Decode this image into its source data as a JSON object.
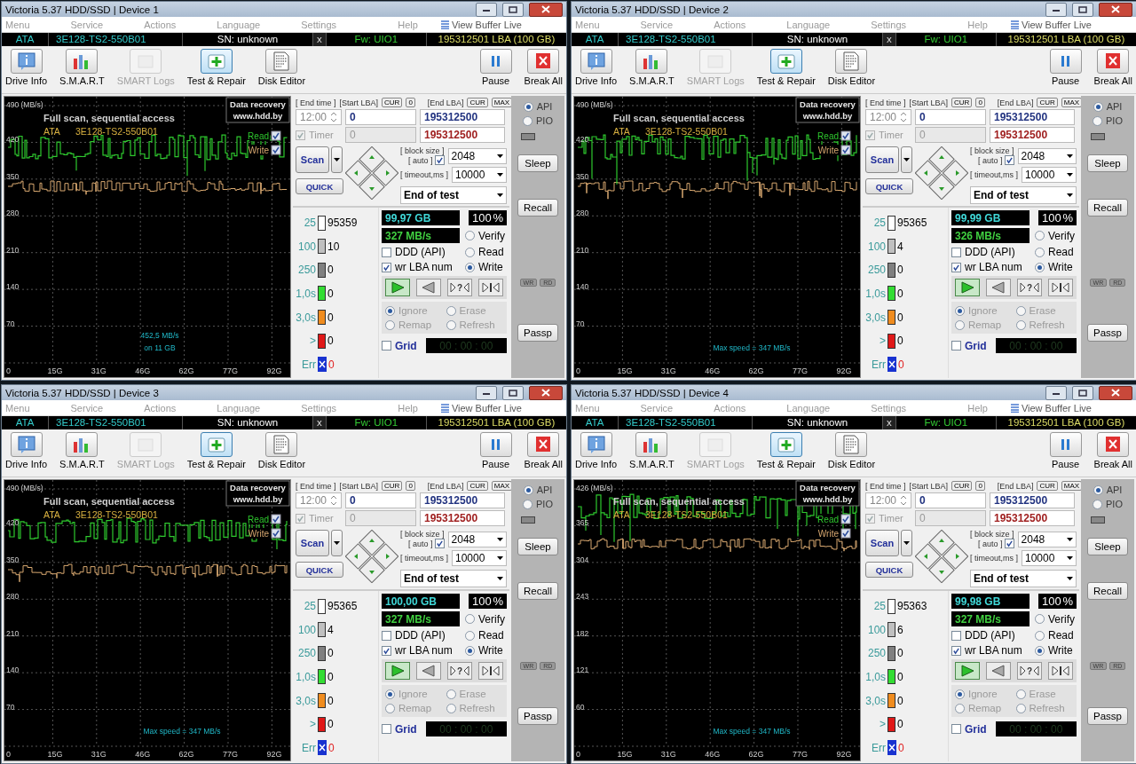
{
  "windows": [
    {
      "title": "Victoria 5.37 HDD/SSD | Device 1",
      "menu": [
        "Menu",
        "Service",
        "Actions",
        "Language",
        "Settings",
        "Help"
      ],
      "buffer_link": "View Buffer Live",
      "drive": {
        "interface": "ATA",
        "model": "3E128-TS2-550B01",
        "serial": "SN: unknown",
        "close": "x",
        "firmware": "Fw: UIO1",
        "capacity": "195312501 LBA (100 GB)"
      },
      "toolbar": [
        {
          "label": "Drive Info",
          "kind": "info",
          "selected": false,
          "disabled": false
        },
        {
          "label": "S.M.A.R.T",
          "kind": "smart",
          "selected": false,
          "disabled": false
        },
        {
          "label": "SMART Logs",
          "kind": "logs",
          "selected": false,
          "disabled": true
        },
        {
          "label": "Test & Repair",
          "kind": "test",
          "selected": true,
          "disabled": false
        },
        {
          "label": "Disk Editor",
          "kind": "editor",
          "selected": false,
          "disabled": false
        }
      ],
      "toolbar_right": [
        {
          "label": "Pause",
          "kind": "pause"
        },
        {
          "label": "Break All",
          "kind": "break"
        }
      ],
      "chart": {
        "y_ticks": [
          "490 (MB/s)",
          "420",
          "350",
          "280",
          "210",
          "140",
          "70"
        ],
        "x_ticks": [
          "0",
          "15G",
          "31G",
          "46G",
          "62G",
          "77G",
          "92G"
        ],
        "title": "Full scan, sequential access",
        "drive_label": "ATA",
        "model": "3E128-TS2-550B01",
        "badge": [
          "Data recovery",
          "www.hdd.by"
        ],
        "legend": [
          {
            "label": "Read",
            "checked": true
          },
          {
            "label": "Write",
            "checked": true
          }
        ],
        "notes": [
          "452,5 MB/s",
          "on 11 GB"
        ]
      },
      "controls": {
        "end_time": {
          "label": "[ End time ]",
          "value": "12:00"
        },
        "timer": {
          "label": "Timer",
          "checked": true
        },
        "start_lba": {
          "label": "[Start LBA]",
          "buttons": [
            "CUR",
            "0"
          ],
          "value": "0",
          "value2": "0"
        },
        "end_lba": {
          "label": "[End LBA]",
          "buttons": [
            "CUR",
            "MAX"
          ],
          "value": "195312500",
          "value2": "195312500"
        },
        "scan": "Scan",
        "quick": "QUICK",
        "block_size": {
          "label": "[ block size ]",
          "auto_label": "[ auto ]",
          "auto": true,
          "value": "2048"
        },
        "timeout": {
          "label": "[ timeout,ms ]",
          "value": "10000"
        },
        "end_action": "End of test",
        "stats": [
          {
            "label": "25",
            "count": "95359",
            "color": "#ffffff",
            "kind": "box"
          },
          {
            "label": "100",
            "count": "10",
            "color": "#c0c0c0",
            "kind": "box"
          },
          {
            "label": "250",
            "count": "0",
            "color": "#808080",
            "kind": "box"
          },
          {
            "label": "1,0s",
            "count": "0",
            "color": "#33dd33",
            "kind": "box"
          },
          {
            "label": "3,0s",
            "count": "0",
            "color": "#f08c1e",
            "kind": "box"
          },
          {
            "label": ">",
            "count": "0",
            "color": "#e01818",
            "kind": "box"
          },
          {
            "label": "Err",
            "count": "0",
            "color": "#1832d0",
            "kind": "err"
          }
        ],
        "progress": {
          "size": "99,97 GB",
          "percent": "100",
          "percent_unit": "%",
          "speed": "327 MB/s"
        },
        "options": [
          {
            "label": "DDD (API)",
            "checked": false
          },
          {
            "label": "wr LBA num",
            "checked": true
          }
        ],
        "modes": [
          {
            "label": "Verify",
            "selected": false
          },
          {
            "label": "Read",
            "selected": false
          },
          {
            "label": "Write",
            "selected": true
          }
        ],
        "transport": [
          {
            "kind": "play",
            "selected": true
          },
          {
            "kind": "back",
            "selected": false
          },
          {
            "kind": "random",
            "label": "?",
            "selected": false
          },
          {
            "kind": "end",
            "selected": false
          }
        ],
        "repair": [
          {
            "label": "Ignore",
            "selected": true
          },
          {
            "label": "Erase",
            "selected": false
          },
          {
            "label": "Remap",
            "selected": false
          },
          {
            "label": "Refresh",
            "selected": false
          }
        ],
        "grid": {
          "label": "Grid",
          "checked": false
        },
        "timer_display": "00 : 00 : 00"
      },
      "side": {
        "ports": [
          {
            "label": "API",
            "selected": true
          },
          {
            "label": "PIO",
            "selected": false
          }
        ],
        "buttons": [
          "Sleep",
          "Recall",
          "Passp"
        ],
        "indicators": [
          "WR",
          "RD"
        ]
      }
    },
    {
      "title": "Victoria 5.37 HDD/SSD | Device 2",
      "menu": [
        "Menu",
        "Service",
        "Actions",
        "Language",
        "Settings",
        "Help"
      ],
      "buffer_link": "View Buffer Live",
      "drive": {
        "interface": "ATA",
        "model": "3E128-TS2-550B01",
        "serial": "SN: unknown",
        "close": "x",
        "firmware": "Fw: UIO1",
        "capacity": "195312501 LBA (100 GB)"
      },
      "toolbar": [
        {
          "label": "Drive Info",
          "kind": "info",
          "selected": false,
          "disabled": false
        },
        {
          "label": "S.M.A.R.T",
          "kind": "smart",
          "selected": false,
          "disabled": false
        },
        {
          "label": "SMART Logs",
          "kind": "logs",
          "selected": false,
          "disabled": true
        },
        {
          "label": "Test & Repair",
          "kind": "test",
          "selected": true,
          "disabled": false
        },
        {
          "label": "Disk Editor",
          "kind": "editor",
          "selected": false,
          "disabled": false
        }
      ],
      "toolbar_right": [
        {
          "label": "Pause",
          "kind": "pause"
        },
        {
          "label": "Break All",
          "kind": "break"
        }
      ],
      "chart": {
        "y_ticks": [
          "490 (MB/s)",
          "420",
          "350",
          "280",
          "210",
          "140",
          "70"
        ],
        "x_ticks": [
          "0",
          "15G",
          "31G",
          "46G",
          "62G",
          "77G",
          "92G"
        ],
        "title": "Full scan, sequential access",
        "drive_label": "ATA",
        "model": "3E128-TS2-550B01",
        "badge": [
          "Data recovery",
          "www.hdd.by"
        ],
        "legend": [
          {
            "label": "Read",
            "checked": true
          },
          {
            "label": "Write",
            "checked": true
          }
        ],
        "notes": [
          "Max speed = 347 MB/s"
        ]
      },
      "controls": {
        "end_time": {
          "label": "[ End time ]",
          "value": "12:00"
        },
        "timer": {
          "label": "Timer",
          "checked": true
        },
        "start_lba": {
          "label": "[Start LBA]",
          "buttons": [
            "CUR",
            "0"
          ],
          "value": "0",
          "value2": "0"
        },
        "end_lba": {
          "label": "[End LBA]",
          "buttons": [
            "CUR",
            "MAX"
          ],
          "value": "195312500",
          "value2": "195312500"
        },
        "scan": "Scan",
        "quick": "QUICK",
        "block_size": {
          "label": "[ block size ]",
          "auto_label": "[ auto ]",
          "auto": true,
          "value": "2048"
        },
        "timeout": {
          "label": "[ timeout,ms ]",
          "value": "10000"
        },
        "end_action": "End of test",
        "stats": [
          {
            "label": "25",
            "count": "95365",
            "color": "#ffffff",
            "kind": "box"
          },
          {
            "label": "100",
            "count": "4",
            "color": "#c0c0c0",
            "kind": "box"
          },
          {
            "label": "250",
            "count": "0",
            "color": "#808080",
            "kind": "box"
          },
          {
            "label": "1,0s",
            "count": "0",
            "color": "#33dd33",
            "kind": "box"
          },
          {
            "label": "3,0s",
            "count": "0",
            "color": "#f08c1e",
            "kind": "box"
          },
          {
            "label": ">",
            "count": "0",
            "color": "#e01818",
            "kind": "box"
          },
          {
            "label": "Err",
            "count": "0",
            "color": "#1832d0",
            "kind": "err"
          }
        ],
        "progress": {
          "size": "99,99 GB",
          "percent": "100",
          "percent_unit": "%",
          "speed": "326 MB/s"
        },
        "options": [
          {
            "label": "DDD (API)",
            "checked": false
          },
          {
            "label": "wr LBA num",
            "checked": true
          }
        ],
        "modes": [
          {
            "label": "Verify",
            "selected": false
          },
          {
            "label": "Read",
            "selected": false
          },
          {
            "label": "Write",
            "selected": true
          }
        ],
        "transport": [
          {
            "kind": "play",
            "selected": true
          },
          {
            "kind": "back",
            "selected": false
          },
          {
            "kind": "random",
            "label": "?",
            "selected": false
          },
          {
            "kind": "end",
            "selected": false
          }
        ],
        "repair": [
          {
            "label": "Ignore",
            "selected": true
          },
          {
            "label": "Erase",
            "selected": false
          },
          {
            "label": "Remap",
            "selected": false
          },
          {
            "label": "Refresh",
            "selected": false
          }
        ],
        "grid": {
          "label": "Grid",
          "checked": false
        },
        "timer_display": "00 : 00 : 00"
      },
      "side": {
        "ports": [
          {
            "label": "API",
            "selected": true
          },
          {
            "label": "PIO",
            "selected": false
          }
        ],
        "buttons": [
          "Sleep",
          "Recall",
          "Passp"
        ],
        "indicators": [
          "WR",
          "RD"
        ]
      }
    },
    {
      "title": "Victoria 5.37 HDD/SSD | Device 3",
      "menu": [
        "Menu",
        "Service",
        "Actions",
        "Language",
        "Settings",
        "Help"
      ],
      "buffer_link": "View Buffer Live",
      "drive": {
        "interface": "ATA",
        "model": "3E128-TS2-550B01",
        "serial": "SN: unknown",
        "close": "x",
        "firmware": "Fw: UIO1",
        "capacity": "195312501 LBA (100 GB)"
      },
      "toolbar": [
        {
          "label": "Drive Info",
          "kind": "info",
          "selected": false,
          "disabled": false
        },
        {
          "label": "S.M.A.R.T",
          "kind": "smart",
          "selected": false,
          "disabled": false
        },
        {
          "label": "SMART Logs",
          "kind": "logs",
          "selected": false,
          "disabled": true
        },
        {
          "label": "Test & Repair",
          "kind": "test",
          "selected": true,
          "disabled": false
        },
        {
          "label": "Disk Editor",
          "kind": "editor",
          "selected": false,
          "disabled": false
        }
      ],
      "toolbar_right": [
        {
          "label": "Pause",
          "kind": "pause"
        },
        {
          "label": "Break All",
          "kind": "break"
        }
      ],
      "chart": {
        "y_ticks": [
          "490 (MB/s)",
          "420",
          "350",
          "280",
          "210",
          "140",
          "70"
        ],
        "x_ticks": [
          "0",
          "15G",
          "31G",
          "46G",
          "62G",
          "77G",
          "92G"
        ],
        "title": "Full scan, sequential access",
        "drive_label": "ATA",
        "model": "3E128-TS2-550B01",
        "badge": [
          "Data recovery",
          "www.hdd.by"
        ],
        "legend": [
          {
            "label": "Read",
            "checked": true
          },
          {
            "label": "Write",
            "checked": true
          }
        ],
        "notes": [
          "Max speed = 347 MB/s"
        ]
      },
      "controls": {
        "end_time": {
          "label": "[ End time ]",
          "value": "12:00"
        },
        "timer": {
          "label": "Timer",
          "checked": true
        },
        "start_lba": {
          "label": "[Start LBA]",
          "buttons": [
            "CUR",
            "0"
          ],
          "value": "0",
          "value2": "0"
        },
        "end_lba": {
          "label": "[End LBA]",
          "buttons": [
            "CUR",
            "MAX"
          ],
          "value": "195312500",
          "value2": "195312500"
        },
        "scan": "Scan",
        "quick": "QUICK",
        "block_size": {
          "label": "[ block size ]",
          "auto_label": "[ auto ]",
          "auto": true,
          "value": "2048"
        },
        "timeout": {
          "label": "[ timeout,ms ]",
          "value": "10000"
        },
        "end_action": "End of test",
        "stats": [
          {
            "label": "25",
            "count": "95365",
            "color": "#ffffff",
            "kind": "box"
          },
          {
            "label": "100",
            "count": "4",
            "color": "#c0c0c0",
            "kind": "box"
          },
          {
            "label": "250",
            "count": "0",
            "color": "#808080",
            "kind": "box"
          },
          {
            "label": "1,0s",
            "count": "0",
            "color": "#33dd33",
            "kind": "box"
          },
          {
            "label": "3,0s",
            "count": "0",
            "color": "#f08c1e",
            "kind": "box"
          },
          {
            "label": ">",
            "count": "0",
            "color": "#e01818",
            "kind": "box"
          },
          {
            "label": "Err",
            "count": "0",
            "color": "#1832d0",
            "kind": "err"
          }
        ],
        "progress": {
          "size": "100,00 GB",
          "percent": "100",
          "percent_unit": "%",
          "speed": "327 MB/s"
        },
        "options": [
          {
            "label": "DDD (API)",
            "checked": false
          },
          {
            "label": "wr LBA num",
            "checked": true
          }
        ],
        "modes": [
          {
            "label": "Verify",
            "selected": false
          },
          {
            "label": "Read",
            "selected": false
          },
          {
            "label": "Write",
            "selected": true
          }
        ],
        "transport": [
          {
            "kind": "play",
            "selected": true
          },
          {
            "kind": "back",
            "selected": false
          },
          {
            "kind": "random",
            "label": "?",
            "selected": false
          },
          {
            "kind": "end",
            "selected": false
          }
        ],
        "repair": [
          {
            "label": "Ignore",
            "selected": true
          },
          {
            "label": "Erase",
            "selected": false
          },
          {
            "label": "Remap",
            "selected": false
          },
          {
            "label": "Refresh",
            "selected": false
          }
        ],
        "grid": {
          "label": "Grid",
          "checked": false
        },
        "timer_display": "00 : 00 : 00"
      },
      "side": {
        "ports": [
          {
            "label": "API",
            "selected": true
          },
          {
            "label": "PIO",
            "selected": false
          }
        ],
        "buttons": [
          "Sleep",
          "Recall",
          "Passp"
        ],
        "indicators": [
          "WR",
          "RD"
        ]
      }
    },
    {
      "title": "Victoria 5.37 HDD/SSD | Device 4",
      "menu": [
        "Menu",
        "Service",
        "Actions",
        "Language",
        "Settings",
        "Help"
      ],
      "buffer_link": "View Buffer Live",
      "drive": {
        "interface": "ATA",
        "model": "3E128-TS2-550B01",
        "serial": "SN: unknown",
        "close": "x",
        "firmware": "Fw: UIO1",
        "capacity": "195312501 LBA (100 GB)"
      },
      "toolbar": [
        {
          "label": "Drive Info",
          "kind": "info",
          "selected": false,
          "disabled": false
        },
        {
          "label": "S.M.A.R.T",
          "kind": "smart",
          "selected": false,
          "disabled": false
        },
        {
          "label": "SMART Logs",
          "kind": "logs",
          "selected": false,
          "disabled": true
        },
        {
          "label": "Test & Repair",
          "kind": "test",
          "selected": true,
          "disabled": false
        },
        {
          "label": "Disk Editor",
          "kind": "editor",
          "selected": false,
          "disabled": false
        }
      ],
      "toolbar_right": [
        {
          "label": "Pause",
          "kind": "pause"
        },
        {
          "label": "Break All",
          "kind": "break"
        }
      ],
      "chart": {
        "y_ticks": [
          "426 (MB/s)",
          "365",
          "304",
          "243",
          "182",
          "121",
          "60"
        ],
        "x_ticks": [
          "0",
          "15G",
          "31G",
          "46G",
          "62G",
          "77G",
          "92G"
        ],
        "title": "Full scan, sequential access",
        "drive_label": "ATA",
        "model": "3E128-TS2-550B01",
        "badge": [
          "Data recovery",
          "www.hdd.by"
        ],
        "legend": [
          {
            "label": "Read",
            "checked": true
          },
          {
            "label": "Write",
            "checked": true
          }
        ],
        "notes": [
          "Max speed = 347 MB/s"
        ]
      },
      "controls": {
        "end_time": {
          "label": "[ End time ]",
          "value": "12:00"
        },
        "timer": {
          "label": "Timer",
          "checked": true
        },
        "start_lba": {
          "label": "[Start LBA]",
          "buttons": [
            "CUR",
            "0"
          ],
          "value": "0",
          "value2": "0"
        },
        "end_lba": {
          "label": "[End LBA]",
          "buttons": [
            "CUR",
            "MAX"
          ],
          "value": "195312500",
          "value2": "195312500"
        },
        "scan": "Scan",
        "quick": "QUICK",
        "block_size": {
          "label": "[ block size ]",
          "auto_label": "[ auto ]",
          "auto": true,
          "value": "2048"
        },
        "timeout": {
          "label": "[ timeout,ms ]",
          "value": "10000"
        },
        "end_action": "End of test",
        "stats": [
          {
            "label": "25",
            "count": "95363",
            "color": "#ffffff",
            "kind": "box"
          },
          {
            "label": "100",
            "count": "6",
            "color": "#c0c0c0",
            "kind": "box"
          },
          {
            "label": "250",
            "count": "0",
            "color": "#808080",
            "kind": "box"
          },
          {
            "label": "1,0s",
            "count": "0",
            "color": "#33dd33",
            "kind": "box"
          },
          {
            "label": "3,0s",
            "count": "0",
            "color": "#f08c1e",
            "kind": "box"
          },
          {
            "label": ">",
            "count": "0",
            "color": "#e01818",
            "kind": "box"
          },
          {
            "label": "Err",
            "count": "0",
            "color": "#1832d0",
            "kind": "err"
          }
        ],
        "progress": {
          "size": "99,98 GB",
          "percent": "100",
          "percent_unit": "%",
          "speed": "327 MB/s"
        },
        "options": [
          {
            "label": "DDD (API)",
            "checked": false
          },
          {
            "label": "wr LBA num",
            "checked": true
          }
        ],
        "modes": [
          {
            "label": "Verify",
            "selected": false
          },
          {
            "label": "Read",
            "selected": false
          },
          {
            "label": "Write",
            "selected": true
          }
        ],
        "transport": [
          {
            "kind": "play",
            "selected": true
          },
          {
            "kind": "back",
            "selected": false
          },
          {
            "kind": "random",
            "label": "?",
            "selected": false
          },
          {
            "kind": "end",
            "selected": false
          }
        ],
        "repair": [
          {
            "label": "Ignore",
            "selected": true
          },
          {
            "label": "Erase",
            "selected": false
          },
          {
            "label": "Remap",
            "selected": false
          },
          {
            "label": "Refresh",
            "selected": false
          }
        ],
        "grid": {
          "label": "Grid",
          "checked": false
        },
        "timer_display": "00 : 00 : 00"
      },
      "side": {
        "ports": [
          {
            "label": "API",
            "selected": true
          },
          {
            "label": "PIO",
            "selected": false
          }
        ],
        "buttons": [
          "Sleep",
          "Recall",
          "Passp"
        ],
        "indicators": [
          "WR",
          "RD"
        ]
      }
    }
  ]
}
